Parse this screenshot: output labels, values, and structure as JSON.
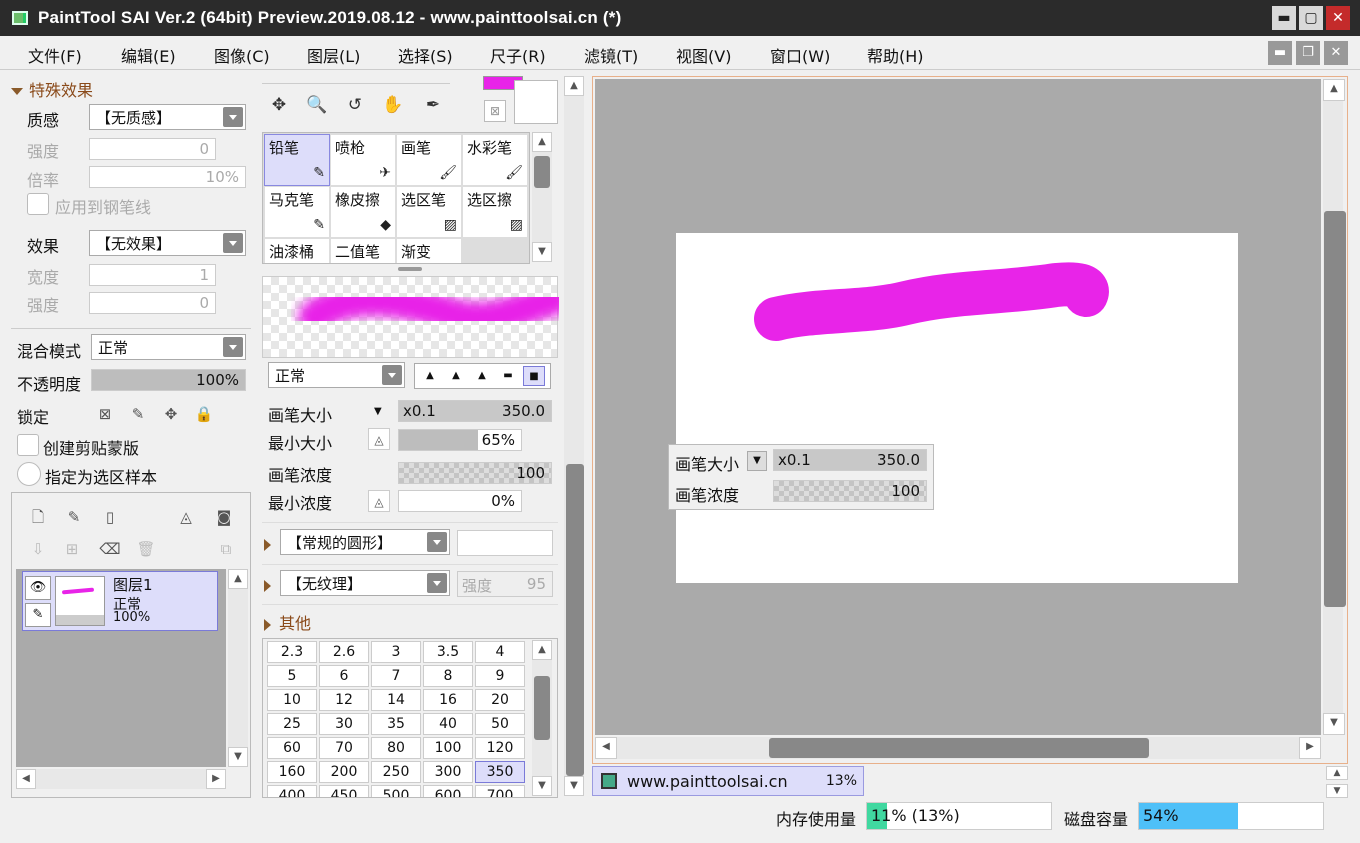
{
  "window": {
    "title": "PaintTool SAI Ver.2 (64bit) Preview.2019.08.12 - www.painttoolsai.cn (*)",
    "min": "▬",
    "max": "▢",
    "close": "✕"
  },
  "menu": [
    "文件(F)",
    "编辑(E)",
    "图像(C)",
    "图层(L)",
    "选择(S)",
    "尺子(R)",
    "滤镜(T)",
    "视图(V)",
    "窗口(W)",
    "帮助(H)"
  ],
  "mdi": {
    "min": "▬",
    "restore": "❐",
    "close": "✕"
  },
  "effects": {
    "header": "特殊效果",
    "texture_label": "质感",
    "texture_value": "【无质感】",
    "strength_label": "强度",
    "strength_value": "0",
    "scale_label": "倍率",
    "scale_value": "10%",
    "apply_pen_label": "应用到钢笔线",
    "effect_label": "效果",
    "effect_value": "【无效果】",
    "width_label": "宽度",
    "width_value": "1",
    "strength2_label": "强度",
    "strength2_value": "0"
  },
  "layer_props": {
    "blend_label": "混合模式",
    "blend_value": "正常",
    "opacity_label": "不透明度",
    "opacity_value": "100%",
    "opacity_fraction": 1.0,
    "lock_label": "锁定",
    "clip_label": "创建剪贴蒙版",
    "sample_label": "指定为选区样本"
  },
  "layers": [
    {
      "name": "图层1",
      "mode": "正常",
      "opacity": "100%"
    }
  ],
  "tools": [
    {
      "name": "铅笔",
      "icon": "✎",
      "selected": true
    },
    {
      "name": "喷枪",
      "icon": "✈",
      "selected": false
    },
    {
      "name": "画笔",
      "icon": "🖌",
      "selected": false
    },
    {
      "name": "水彩笔",
      "icon": "🖌",
      "selected": false
    },
    {
      "name": "马克笔",
      "icon": "✎",
      "selected": false
    },
    {
      "name": "橡皮擦",
      "icon": "◆",
      "selected": false
    },
    {
      "name": "选区笔",
      "icon": "▨",
      "selected": false
    },
    {
      "name": "选区擦",
      "icon": "▨",
      "selected": false
    },
    {
      "name": "油漆桶",
      "icon": "",
      "selected": false
    },
    {
      "name": "二值笔",
      "icon": "",
      "selected": false
    },
    {
      "name": "渐变",
      "icon": "",
      "selected": false
    }
  ],
  "brush": {
    "mode_value": "正常",
    "size_label": "画笔大小",
    "size_mult": "x0.1",
    "size_value": "350.0",
    "min_size_label": "最小大小",
    "min_size_value": "65%",
    "min_size_fraction": 0.65,
    "density_label": "画笔浓度",
    "density_value": "100",
    "min_density_label": "最小浓度",
    "min_density_value": "0%",
    "shape_value": "【常规的圆形】",
    "texture_value": "【无纹理】",
    "texture_strength_label": "强度",
    "texture_strength_value": "95",
    "other_label": "其他"
  },
  "sizes": [
    "2.3",
    "2.6",
    "3",
    "3.5",
    "4",
    "5",
    "6",
    "7",
    "8",
    "9",
    "10",
    "12",
    "14",
    "16",
    "20",
    "25",
    "30",
    "35",
    "40",
    "50",
    "60",
    "70",
    "80",
    "100",
    "120",
    "160",
    "200",
    "250",
    "300",
    "350",
    "400",
    "450",
    "500",
    "600",
    "700"
  ],
  "selected_size": "350",
  "colors": {
    "primary": "#e824e8",
    "stroke": "#e824e8"
  },
  "float_panel": {
    "size_label": "画笔大小",
    "size_mult": "x0.1",
    "size_value": "350.0",
    "density_label": "画笔浓度",
    "density_value": "100"
  },
  "tab": {
    "name": "www.painttoolsai.cn",
    "zoom": "13%"
  },
  "status": {
    "mem_label": "内存使用量",
    "mem_value": "11% (13%)",
    "mem_fraction": 0.11,
    "disk_label": "磁盘容量",
    "disk_value": "54%",
    "disk_fraction": 0.54
  }
}
